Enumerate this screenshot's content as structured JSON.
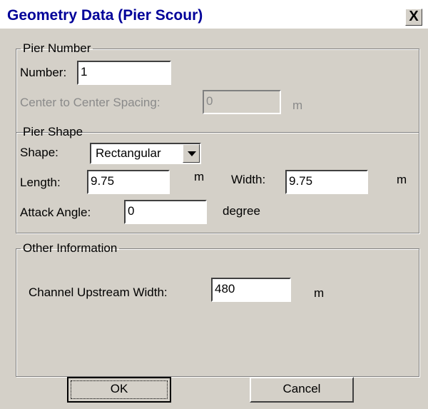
{
  "window": {
    "title": "Geometry Data (Pier Scour)",
    "close_label": "X"
  },
  "pier_number": {
    "legend": "Pier Number",
    "number_label": "Number:",
    "number_value": "1",
    "spacing_label": "Center to Center Spacing:",
    "spacing_value": "0",
    "spacing_unit": "m"
  },
  "pier_shape": {
    "legend": "Pier Shape",
    "shape_label": "Shape:",
    "shape_value": "Rectangular",
    "length_label": "Length:",
    "length_value": "9.75",
    "length_unit": "m",
    "width_label": "Width:",
    "width_value": "9.75",
    "width_unit": "m",
    "attack_label": "Attack Angle:",
    "attack_value": "0",
    "attack_unit": "degree"
  },
  "other_info": {
    "legend": "Other Information",
    "channel_label": "Channel Upstream Width:",
    "channel_value": "480",
    "channel_unit": "m"
  },
  "buttons": {
    "ok": "OK",
    "cancel": "Cancel"
  },
  "icons": [
    "chevron-down-icon",
    "close-icon"
  ]
}
